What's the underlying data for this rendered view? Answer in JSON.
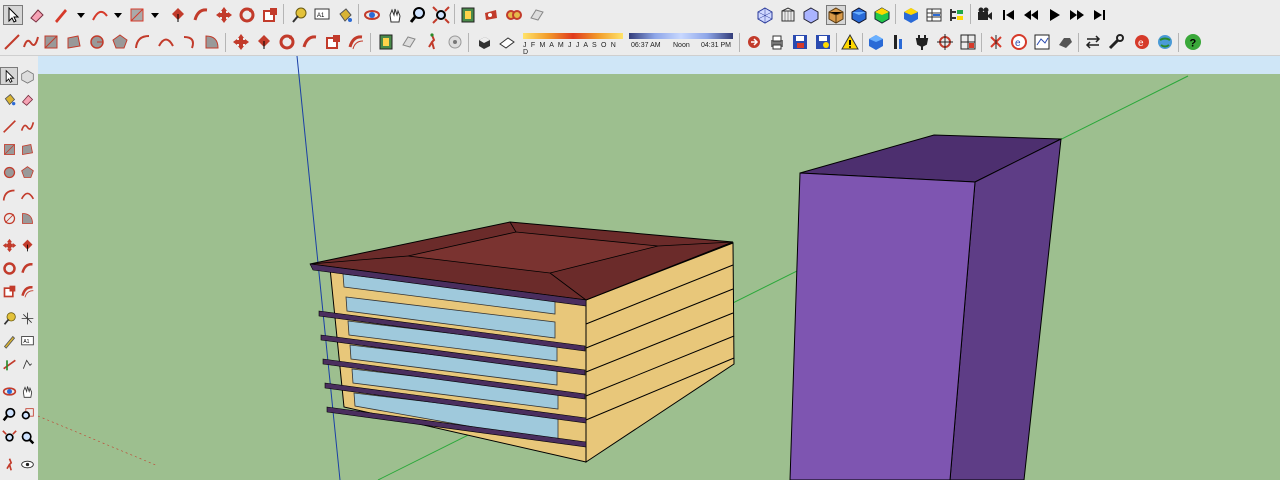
{
  "sun_settings": {
    "months_label": "J F M A M J J A S O N D",
    "time_start": "06:37 AM",
    "time_mid": "Noon",
    "time_end": "04:31 PM"
  },
  "scene": {
    "sky_color": "#cfe6f7",
    "ground_color": "#9dbf8f",
    "axis_blue": "#1a3fa6",
    "axis_green": "#2aa83a",
    "axis_red": "#c23b2b",
    "building_floor_color": "#e8c77a",
    "building_slab_color": "#4a2e5e",
    "building_roof_color": "#6b2b2a",
    "glass_color": "#9fc9dc",
    "tower_front_color": "#7e55b1",
    "tower_side_color": "#5e3d86",
    "tower_top_color": "#4d2f6f"
  },
  "toolbar": {
    "selected_tool": "select",
    "active_style": "shaded-with-textures"
  }
}
